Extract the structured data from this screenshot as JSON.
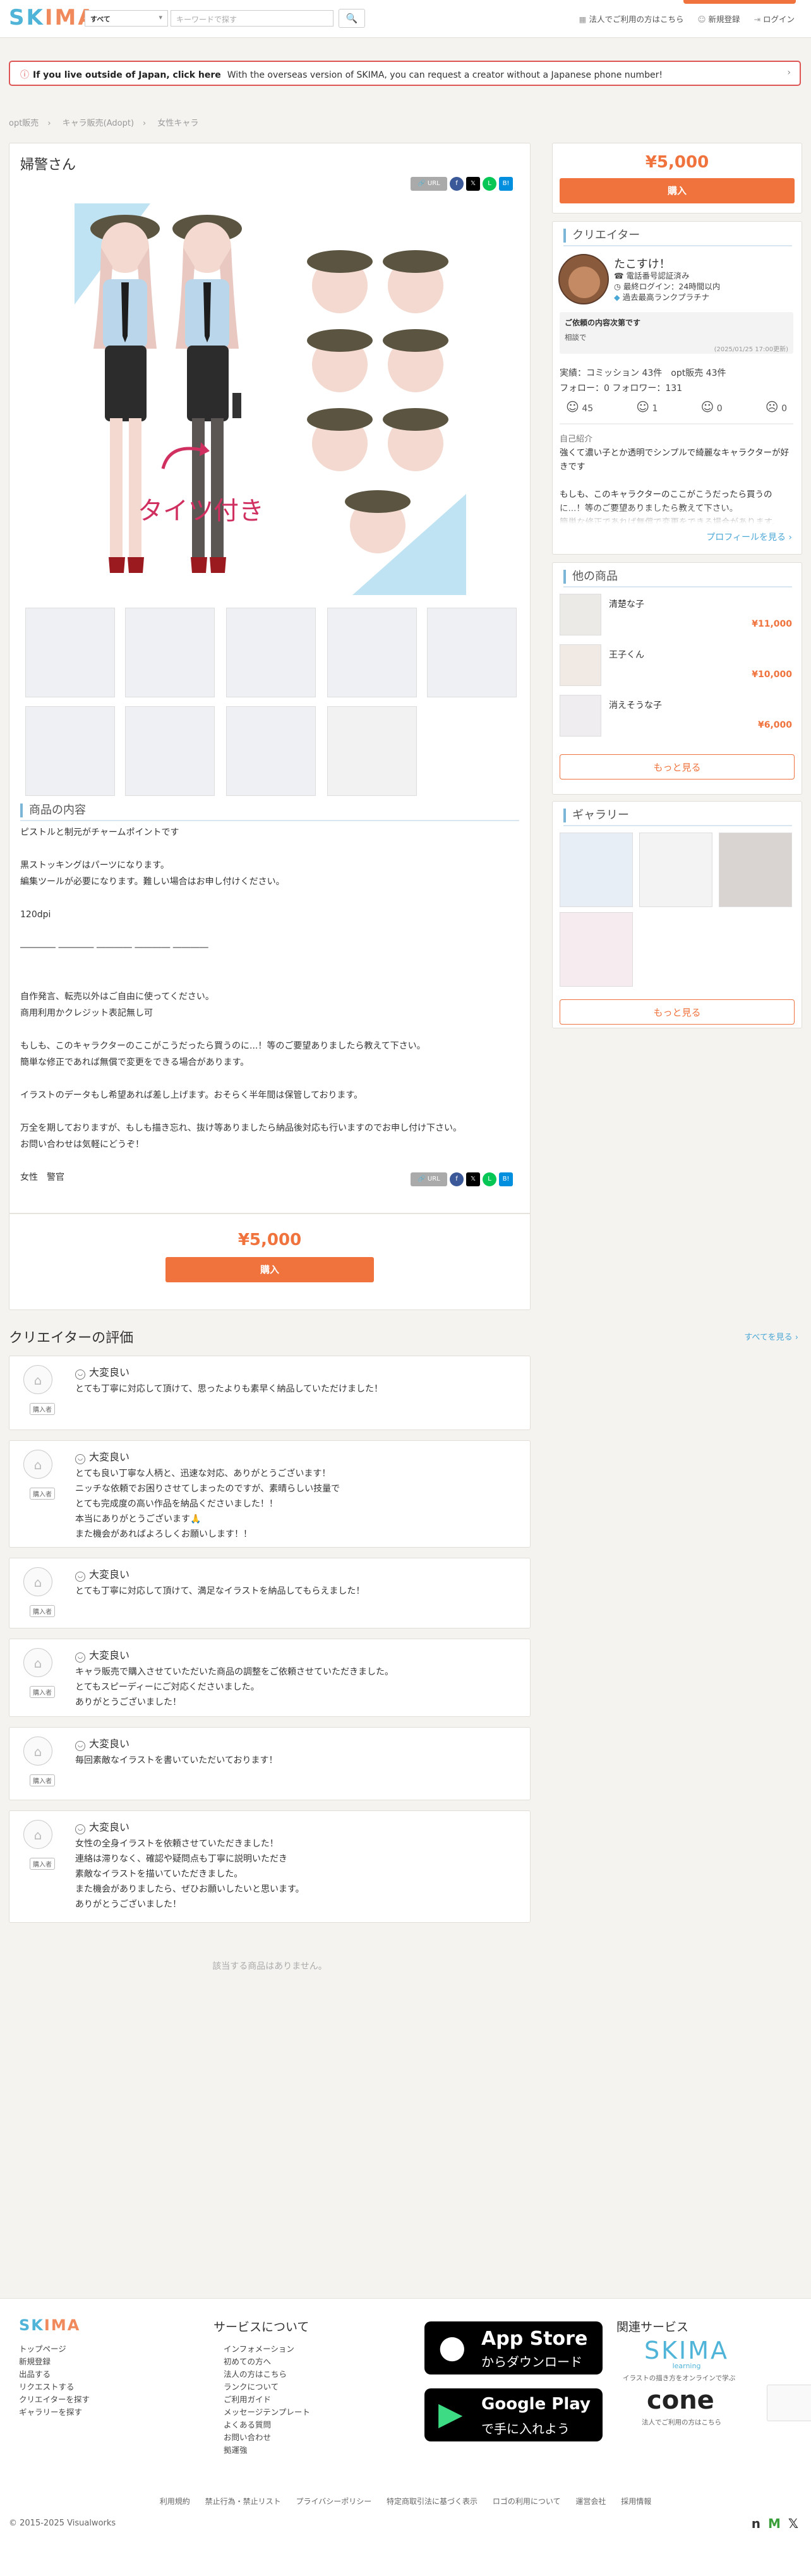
{
  "header": {
    "logo_a": "SK",
    "logo_b": "IMA",
    "category": "すべて",
    "search_placeholder": "キーワードで探す",
    "links": [
      "法人でご利用の方はこちら",
      "新規登録",
      "ログイン"
    ]
  },
  "banner": {
    "bold": "If you live outside of Japan, click here",
    "text": "With the overseas version of SKIMA, you can request a creator without a Japanese phone number!"
  },
  "breadcrumb": [
    "opt販売",
    "キャラ販売(Adopt)",
    "女性キャラ"
  ],
  "product": {
    "title": "婦警さん",
    "share_link": "URL",
    "price": "¥5,000",
    "buy": "購入",
    "desc_heading": "商品の内容",
    "description": "ピストルと制元がチャームポイントです\n\n黒ストッキングはパーツになります。\n編集ツールが必要になります。難しい場合はお申し付けください。\n\n120dpi\n\n―――― ―――― ―――― ―――― ――――\n\n\n自作発言、転売以外はご自由に使ってください。\n商用利用かクレジット表記無し可\n\nもしも、このキャラクターのここがこうだったら買うのに...！等のご要望ありましたら教えて下さい。\n簡単な修正であれば無償で変更をできる場合があります。\n\nイラストのデータもし希望あれば差し上げます。おそらく半年間は保管しております。\n\n万全を期しておりますが、もしも描き忘れ、抜け等ありましたら納品後対応も行いますのでお申し付け下さい。\nお問い合わせは気軽にどうぞ！\n\n女性　警官",
    "hero_note": "タイツ付き"
  },
  "sidebar": {
    "price": "¥5,000",
    "buy": "購入",
    "creator_heading": "クリエイター",
    "creator_name": "たこすけ！",
    "creator_meta": [
      "電話番号認証済み",
      "最終ログイン：24時間以内",
      "過去最高ランクプラチナ"
    ],
    "notice_title": "ご依頼の内容次第です",
    "notice_body": "相談で",
    "notice_date": "(2025/01/25 17:00更新)",
    "stats": "実績：コミッション 43件　opt販売 43件",
    "follow": "フォロー：0 フォロワー：131",
    "reactions": [
      "45",
      "1",
      "0",
      "0"
    ],
    "intro_label": "自己紹介",
    "intro": "強くて濃い子とか透明でシンプルで綺麗なキャラクターが好きです\n\nもしも、このキャラクターのここがこうだったら買うのに...！等のご要望ありましたら教えて下さい。\n簡単な修正であれば無償で変更をできる場合があります。",
    "profile_link": "プロフィールを見る ›",
    "other_heading": "他の商品",
    "others": [
      {
        "name": "清楚な子",
        "price": "¥11,000"
      },
      {
        "name": "王子くん",
        "price": "¥10,000"
      },
      {
        "name": "消えそうな子",
        "price": "¥6,000"
      }
    ],
    "more": "もっと見る",
    "gallery_heading": "ギャラリー",
    "gallery_more": "もっと見る"
  },
  "reviews": {
    "heading": "クリエイターの評価",
    "all": "すべてを見る ›",
    "buyer": "購入者",
    "items": [
      {
        "rating": "大変良い",
        "text": "とても丁寧に対応して頂けて、思ったよりも素早く納品していただけました！"
      },
      {
        "rating": "大変良い",
        "text": "とても良い丁寧な人柄と、迅速な対応、ありがとうございます！\nニッチな依頼でお困りさせてしまったのですが、素晴らしい技量で\nとても完成度の高い作品を納品くださいました！！\n本当にありがとうございます🙏\nまた機会があればよろしくお願いします！！"
      },
      {
        "rating": "大変良い",
        "text": "とても丁寧に対応して頂けて、満足なイラストを納品してもらえました！"
      },
      {
        "rating": "大変良い",
        "text": "キャラ販売で購入させていただいた商品の調整をご依頼させていただきました。\nとてもスピーディーにご対応くださいました。\nありがとうございました！"
      },
      {
        "rating": "大変良い",
        "text": "毎回素敵なイラストを書いていただいております！"
      },
      {
        "rating": "大変良い",
        "text": "女性の全身イラストを依頼させていただきました！\n連絡は滞りなく、確認や疑問点も丁寧に説明いただき\n素敵なイラストを描いていただきました。\nまた機会がありましたら、ぜひお願いしたいと思います。\nありがとうございました！"
      }
    ]
  },
  "no_products": "該当する商品はありません。",
  "footer": {
    "logo": "SKIMA",
    "col1": [
      "トップページ",
      "新規登録",
      "出品する",
      "リクエストする",
      "クリエイターを探す",
      "ギャラリーを探す"
    ],
    "service_heading": "サービスについて",
    "col2": [
      "インフォメーション",
      "初めての方へ",
      "法人の方はこちら",
      "ランクについて",
      "ご利用ガイド",
      "メッセージテンプレート",
      "よくある質問",
      "お問い合わせ",
      "拠運強"
    ],
    "appstore_1": "App Store",
    "appstore_2": "からダウンロード",
    "gplay_1": "Google Play",
    "gplay_2": "で手に入れよう",
    "related_heading": "関連サービス",
    "rel1": "SKIMA",
    "rel1_sub": "learning",
    "rel1_caption": "イラストの描き方をオンラインで学ぶ",
    "rel2": "cone",
    "rel2_caption": "法人でご利用の方はこちら",
    "links": [
      "利用規約",
      "禁止行為・禁止リスト",
      "プライバシーポリシー",
      "特定商取引法に基づく表示",
      "ロゴの利用について",
      "運営会社",
      "採用情報"
    ],
    "copyright": "© 2015-2025 Visualworks"
  },
  "colors": {
    "accent": "#f0733e",
    "heading_bar": "#7bb6d6",
    "link": "#4aa7d6"
  }
}
